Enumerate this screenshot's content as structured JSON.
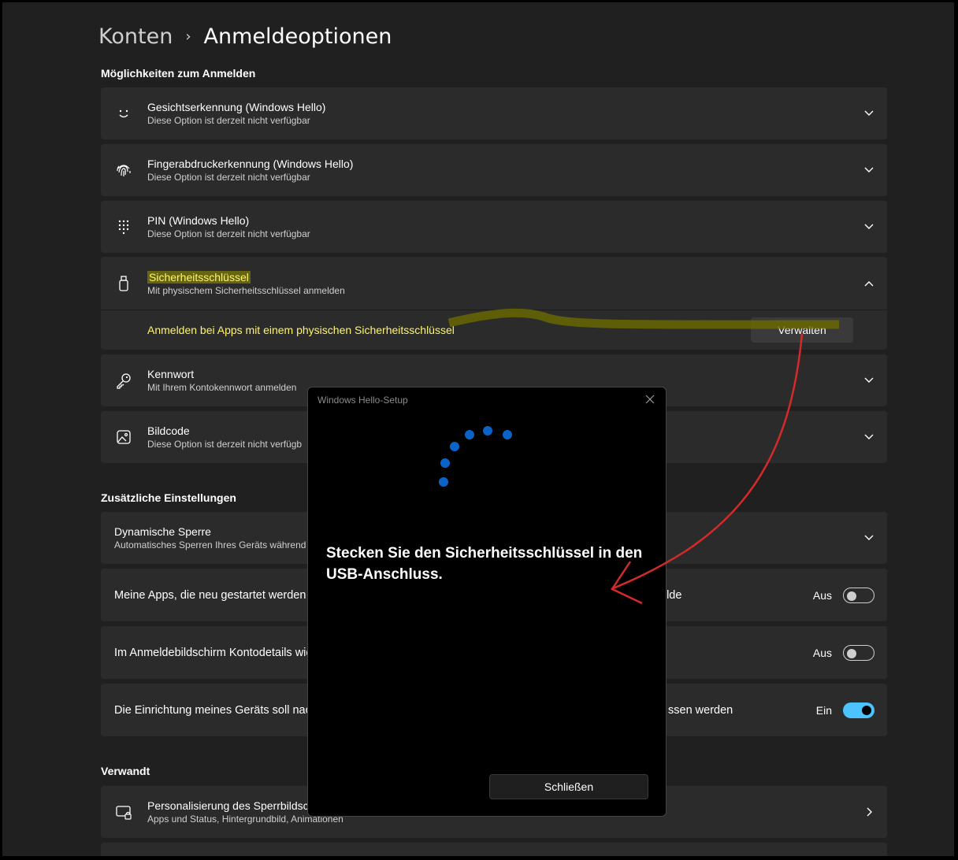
{
  "breadcrumb": {
    "parent": "Konten",
    "separator": "›",
    "current": "Anmeldeoptionen"
  },
  "sections": {
    "signin": "Möglichkeiten zum Anmelden",
    "additional": "Zusätzliche Einstellungen",
    "related": "Verwandt"
  },
  "signin_options": [
    {
      "title": "Gesichtserkennung (Windows Hello)",
      "sub": "Diese Option ist derzeit nicht verfügbar",
      "icon": "face-icon"
    },
    {
      "title": "Fingerabdruckerkennung (Windows Hello)",
      "sub": "Diese Option ist derzeit nicht verfügbar",
      "icon": "fingerprint-icon"
    },
    {
      "title": "PIN (Windows Hello)",
      "sub": "Diese Option ist derzeit nicht verfügbar",
      "icon": "keypad-icon"
    },
    {
      "title": "Sicherheitsschlüssel",
      "sub": "Mit physischem Sicherheitsschlüssel anmelden",
      "icon": "usb-key-icon"
    },
    {
      "title": "Kennwort",
      "sub": "Mit Ihrem Kontokennwort anmelden",
      "icon": "key-icon"
    },
    {
      "title": "Bildcode",
      "sub": "Diese Option ist derzeit nicht verfügb",
      "icon": "picture-icon"
    }
  ],
  "security_key": {
    "expanded_text": "Anmelden bei Apps mit einem physischen Sicherheitsschlüssel",
    "manage_label": "Verwalten"
  },
  "additional_settings": [
    {
      "title": "Dynamische Sperre",
      "sub": "Automatisches Sperren Ihres Geräts während"
    },
    {
      "title_left": "Meine Apps, die neu gestartet werden k",
      "title_right": "elde",
      "state": "Aus",
      "on": false
    },
    {
      "title_left": "Im Anmeldebildschirm Kontodetails wie",
      "title_right": "",
      "state": "Aus",
      "on": false
    },
    {
      "title_left": "Die Einrichtung meines Geräts soll nach",
      "title_right": "ssen werden",
      "state": "Ein",
      "on": true
    }
  ],
  "related": [
    {
      "title": "Personalisierung des Sperrbildsch",
      "sub": "Apps und Status, Hintergrundbild, Animationen",
      "icon": "lock-screen-icon"
    }
  ],
  "dialog": {
    "title": "Windows Hello-Setup",
    "message": "Stecken Sie den Sicherheitsschlüssel in den USB-Anschluss.",
    "close_label": "Schließen"
  },
  "colors": {
    "accent": "#4cc2ff",
    "spinner": "#0a64c8",
    "annotation": "#d42a2a",
    "highlight": "#fff46a"
  }
}
